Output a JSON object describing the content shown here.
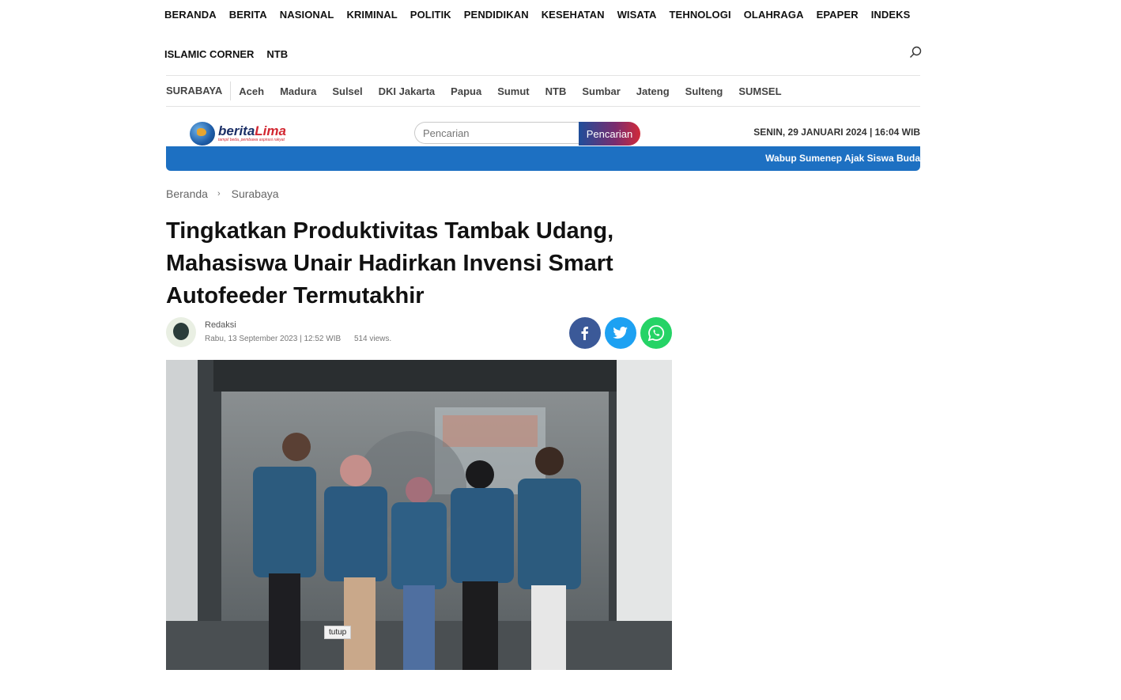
{
  "nav_primary": [
    "BERANDA",
    "BERITA",
    "NASIONAL",
    "KRIMINAL",
    "POLITIK",
    "PENDIDIKAN",
    "KESEHATAN",
    "WISATA",
    "TEHNOLOGI",
    "OLAHRAGA",
    "EPAPER",
    "INDEKS"
  ],
  "nav_secondary": [
    "ISLAMIC CORNER",
    "NTB"
  ],
  "nav_regions": [
    "SURABAYA",
    "Aceh",
    "Madura",
    "Sulsel",
    "DKI Jakarta",
    "Papua",
    "Sumut",
    "NTB",
    "Sumbar",
    "Jateng",
    "Sulteng",
    "SUMSEL"
  ],
  "logo": {
    "brand_a": "berita",
    "brand_b": "Lima",
    "tagline": "tampil beda, pembawa aspirasi rakyat"
  },
  "search": {
    "placeholder": "Pencarian",
    "button": "Pencarian"
  },
  "datetime": "SENIN, 29 JANUARI 2024 | 16:04 WIB",
  "ticker": "Wabup Sumenep Ajak Siswa Buda",
  "breadcrumb": {
    "home": "Beranda",
    "sep": "›",
    "current": "Surabaya"
  },
  "article": {
    "title": "Tingkatkan Produktivitas Tambak Udang, Mahasiswa Unair Hadirkan Invensi Smart Autofeeder Termutakhir",
    "author": "Redaksi",
    "date": "Rabu, 13 September 2023 | 12:52 WIB",
    "views": "514 views.",
    "image_tag": "tutup"
  },
  "colors": {
    "facebook": "#3b5998",
    "twitter": "#1da1f2",
    "whatsapp": "#25d366",
    "ticker": "#1d70c2"
  },
  "icons": [
    "search-icon",
    "facebook-icon",
    "twitter-icon",
    "whatsapp-icon",
    "chevron-right-icon"
  ]
}
